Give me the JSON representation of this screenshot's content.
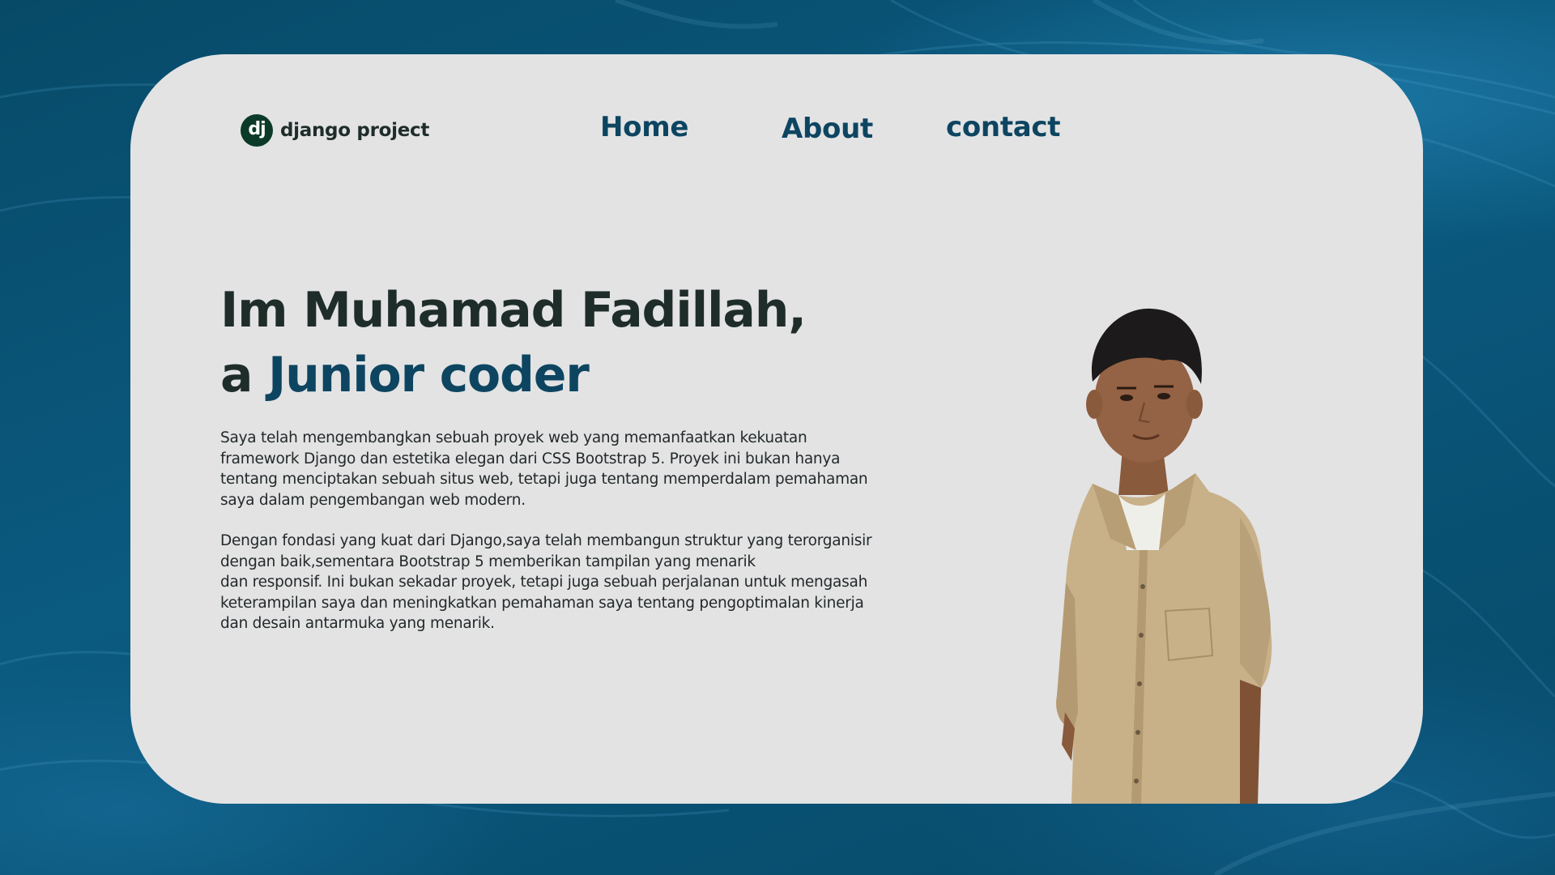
{
  "logo": {
    "mark": "dj",
    "text": "django project"
  },
  "nav": {
    "home": "Home",
    "about": "About",
    "contact": "contact"
  },
  "hero": {
    "line1": "Im Muhamad Fadillah,",
    "line2_prefix": "a ",
    "line2_accent": "Junior coder"
  },
  "paragraphs": {
    "p1": [
      "Saya telah mengembangkan sebuah proyek web yang memanfaatkan kekuatan",
      "framework Django dan estetika elegan dari CSS Bootstrap 5. Proyek ini bukan hanya",
      "tentang menciptakan sebuah situs web, tetapi juga tentang memperdalam pemahaman",
      "saya dalam pengembangan web modern."
    ],
    "p2": [
      "Dengan fondasi yang kuat dari Django,saya telah membangun struktur yang terorganisir",
      "dengan baik,sementara Bootstrap 5 memberikan tampilan yang menarik",
      "dan responsif. Ini bukan sekadar proyek, tetapi juga sebuah perjalanan untuk mengasah",
      "keterampilan saya dan meningkatkan pemahaman saya tentang pengoptimalan kinerja",
      "dan desain antarmuka yang menarik."
    ]
  },
  "colors": {
    "background": "#0a5274",
    "card": "#e3e3e4",
    "accent": "#0d4561",
    "heading": "#1f2d2a",
    "logo_mark": "#0c3a29"
  },
  "images": {
    "portrait": "person-portrait"
  }
}
